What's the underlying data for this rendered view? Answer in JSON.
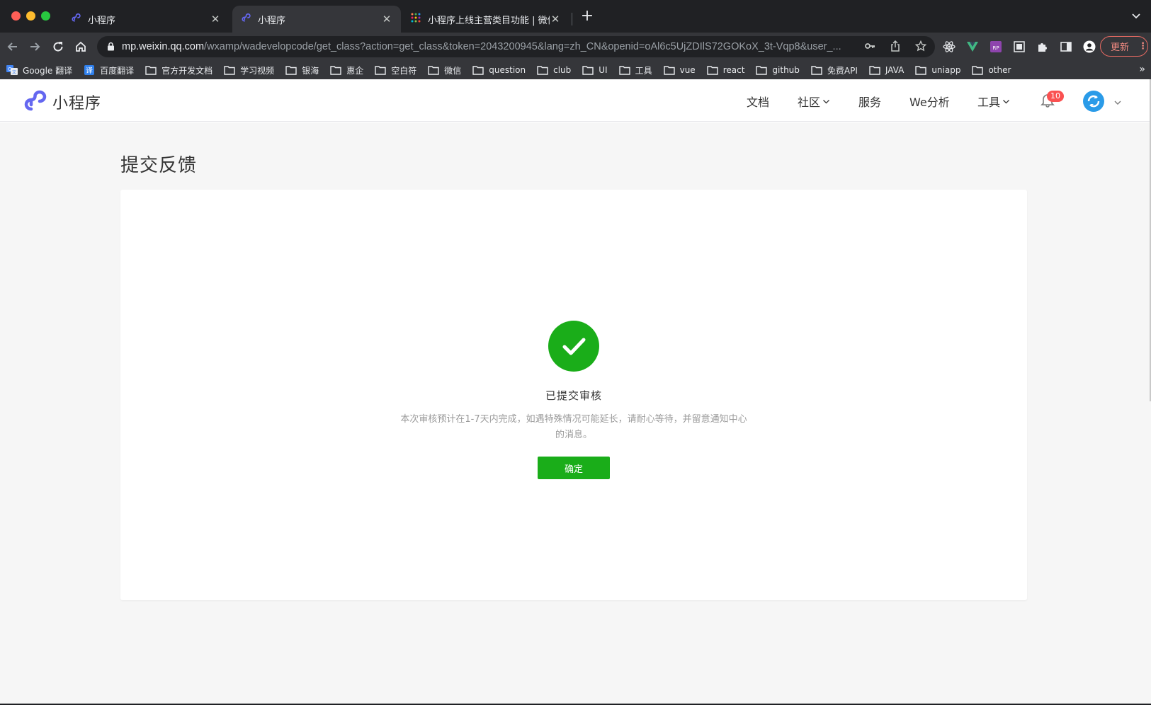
{
  "browser": {
    "tabs": [
      {
        "title": "小程序",
        "active": false
      },
      {
        "title": "小程序",
        "active": true
      },
      {
        "title": "小程序上线主营类目功能 | 微信开",
        "active": false
      }
    ],
    "new_tab_label": "+",
    "url_host": "mp.weixin.qq.com",
    "url_path": "/wxamp/wadevelopcode/get_class?action=get_class&token=2043200945&lang=zh_CN&openid=oAl6c5UjZDIlS72GOKoX_3t-Vqp8&user_...",
    "update_label": "更新",
    "bookmarks": [
      {
        "label": "Google 翻译",
        "icon": "google-translate-icon"
      },
      {
        "label": "百度翻译",
        "icon": "baidu-translate-icon"
      },
      {
        "label": "官方开发文档",
        "icon": "folder-icon"
      },
      {
        "label": "学习视频",
        "icon": "folder-icon"
      },
      {
        "label": "银海",
        "icon": "folder-icon"
      },
      {
        "label": "惠企",
        "icon": "folder-icon"
      },
      {
        "label": "空白符",
        "icon": "folder-icon"
      },
      {
        "label": "微信",
        "icon": "folder-icon"
      },
      {
        "label": "question",
        "icon": "folder-icon"
      },
      {
        "label": "club",
        "icon": "folder-icon"
      },
      {
        "label": "UI",
        "icon": "folder-icon"
      },
      {
        "label": "工具",
        "icon": "folder-icon"
      },
      {
        "label": "vue",
        "icon": "folder-icon"
      },
      {
        "label": "react",
        "icon": "folder-icon"
      },
      {
        "label": "github",
        "icon": "folder-icon"
      },
      {
        "label": "免费API",
        "icon": "folder-icon"
      },
      {
        "label": "JAVA",
        "icon": "folder-icon"
      },
      {
        "label": "uniapp",
        "icon": "folder-icon"
      },
      {
        "label": "other",
        "icon": "folder-icon"
      }
    ],
    "bookmarks_more": "»"
  },
  "site": {
    "logo_text": "小程序",
    "nav": {
      "docs": "文档",
      "community": "社区",
      "services": "服务",
      "analytics": "We分析",
      "tools": "工具"
    },
    "notification_count": "10",
    "brand_color": "#1aad19"
  },
  "page": {
    "title": "提交反馈",
    "result": {
      "title": "已提交审核",
      "description": "本次审核预计在1-7天内完成，如遇特殊情况可能延长，请耐心等待，并留意通知中心的消息。",
      "confirm_label": "确定"
    }
  }
}
